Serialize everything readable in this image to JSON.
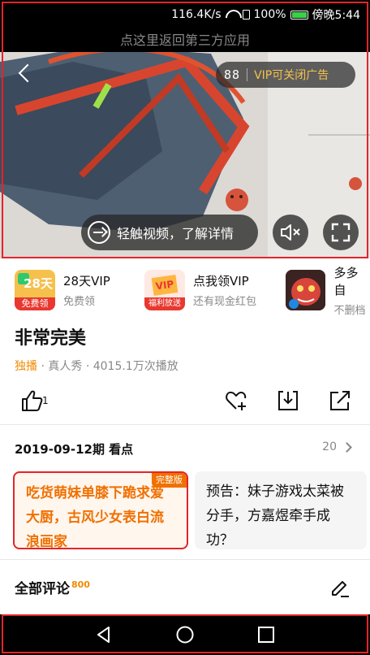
{
  "status_bar": {
    "speed": "116.4K/s",
    "battery": "100%",
    "time": "傍晚5:44"
  },
  "video": {
    "return_banner": "点这里返回第三方应用",
    "countdown": "88",
    "vip_close_ad": "VIP可关闭广告",
    "detail_cta": "轻触视频，了解详情"
  },
  "promos": [
    {
      "title": "28天VIP",
      "subtitle": "免费领",
      "thumb_text": "28天",
      "thumb_sub": "免费领"
    },
    {
      "title": "点我领VIP",
      "subtitle": "还有现金红包",
      "thumb_text": "VIP",
      "thumb_sub": "福利放送"
    },
    {
      "title": "多多自",
      "subtitle": "不删档"
    }
  ],
  "show": {
    "title": "非常完美",
    "exclusive": "独播",
    "category": "真人秀",
    "plays": "4015.1万次播放",
    "like_count": "1"
  },
  "episodes": {
    "period_label": "2019-09-12期 看点",
    "count": "20",
    "cards": [
      {
        "text": "吃货萌妹单膝下跪求爱大厨，古风少女表白流浪画家",
        "badge": "完整版"
      },
      {
        "text": "预告：妹子游戏太菜被分手，方嘉煜牵手成功？"
      }
    ]
  },
  "comments": {
    "label": "全部评论",
    "count": "800"
  }
}
